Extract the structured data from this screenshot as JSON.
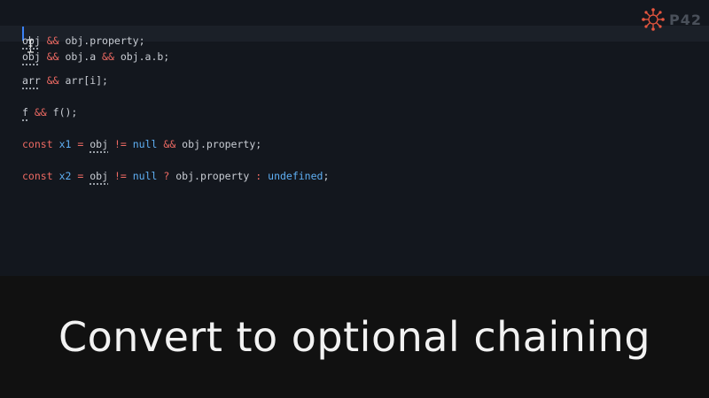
{
  "logo": {
    "text": "P42"
  },
  "editor": {
    "lines": [
      {
        "tokens": []
      },
      {
        "tokens": [
          {
            "text": "obj",
            "cls": "dotted"
          },
          {
            "text": " "
          },
          {
            "text": "&&",
            "cls": "op"
          },
          {
            "text": " obj.property;"
          }
        ]
      },
      {
        "tokens": [
          {
            "text": "obj",
            "cls": "dotted"
          },
          {
            "text": " "
          },
          {
            "text": "&&",
            "cls": "op"
          },
          {
            "text": " obj.a "
          },
          {
            "text": "&&",
            "cls": "op"
          },
          {
            "text": " obj.a.b;"
          }
        ]
      },
      {
        "tokens": [
          {
            "text": "arr",
            "cls": "dotted"
          },
          {
            "text": " "
          },
          {
            "text": "&&",
            "cls": "op"
          },
          {
            "text": " arr[i];"
          }
        ]
      },
      {
        "tokens": [
          {
            "text": "f",
            "cls": "dotted"
          },
          {
            "text": " "
          },
          {
            "text": "&&",
            "cls": "op"
          },
          {
            "text": " f();"
          }
        ]
      },
      {
        "tokens": [
          {
            "text": "const",
            "cls": "kw"
          },
          {
            "text": " "
          },
          {
            "text": "x1",
            "cls": "lit"
          },
          {
            "text": " "
          },
          {
            "text": "=",
            "cls": "op"
          },
          {
            "text": " "
          },
          {
            "text": "obj",
            "cls": "dotted"
          },
          {
            "text": " "
          },
          {
            "text": "!=",
            "cls": "op"
          },
          {
            "text": " "
          },
          {
            "text": "null",
            "cls": "lit"
          },
          {
            "text": " "
          },
          {
            "text": "&&",
            "cls": "op"
          },
          {
            "text": " obj.property;"
          }
        ]
      },
      {
        "tokens": [
          {
            "text": "const",
            "cls": "kw"
          },
          {
            "text": " "
          },
          {
            "text": "x2",
            "cls": "lit"
          },
          {
            "text": " "
          },
          {
            "text": "=",
            "cls": "op"
          },
          {
            "text": " "
          },
          {
            "text": "obj",
            "cls": "dotted"
          },
          {
            "text": " "
          },
          {
            "text": "!=",
            "cls": "op"
          },
          {
            "text": " "
          },
          {
            "text": "null",
            "cls": "lit"
          },
          {
            "text": " "
          },
          {
            "text": "?",
            "cls": "op"
          },
          {
            "text": " obj.property "
          },
          {
            "text": ":",
            "cls": "op"
          },
          {
            "text": " "
          },
          {
            "text": "undefined",
            "cls": "lit"
          },
          {
            "text": ";"
          }
        ]
      }
    ]
  },
  "caption": {
    "text": "Convert to optional chaining"
  },
  "colors": {
    "background": "#13171e",
    "operator": "#ee6a63",
    "literal": "#5fb0f5",
    "caret": "#3b82f6",
    "logo_mark": "#e8563f"
  }
}
